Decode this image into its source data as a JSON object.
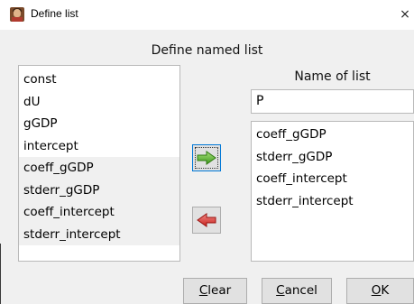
{
  "window": {
    "title": "Define list",
    "close_glyph": "×",
    "icon": "app-icon"
  },
  "dialog": {
    "heading": "Define named list"
  },
  "available_list": {
    "items": [
      {
        "label": "const",
        "selected": false
      },
      {
        "label": "dU",
        "selected": false
      },
      {
        "label": "gGDP",
        "selected": false
      },
      {
        "label": "intercept",
        "selected": false
      },
      {
        "label": "coeff_gGDP",
        "selected": true
      },
      {
        "label": "stderr_gGDP",
        "selected": true
      },
      {
        "label": "coeff_intercept",
        "selected": true
      },
      {
        "label": "stderr_intercept",
        "selected": true
      }
    ]
  },
  "name_field": {
    "label": "Name of list",
    "value": "P"
  },
  "selected_list": {
    "items": [
      {
        "label": "coeff_gGDP"
      },
      {
        "label": "stderr_gGDP"
      },
      {
        "label": "coeff_intercept"
      },
      {
        "label": "stderr_intercept"
      }
    ]
  },
  "arrows": {
    "add": {
      "icon": "right-arrow-icon",
      "color": "#4caf28"
    },
    "remove": {
      "icon": "left-arrow-icon",
      "color": "#d9302c"
    }
  },
  "buttons": {
    "clear": {
      "mnemonic": "C",
      "rest": "lear"
    },
    "cancel": {
      "mnemonic": "C",
      "rest": "ancel"
    },
    "ok": {
      "mnemonic": "O",
      "rest": "K"
    }
  }
}
